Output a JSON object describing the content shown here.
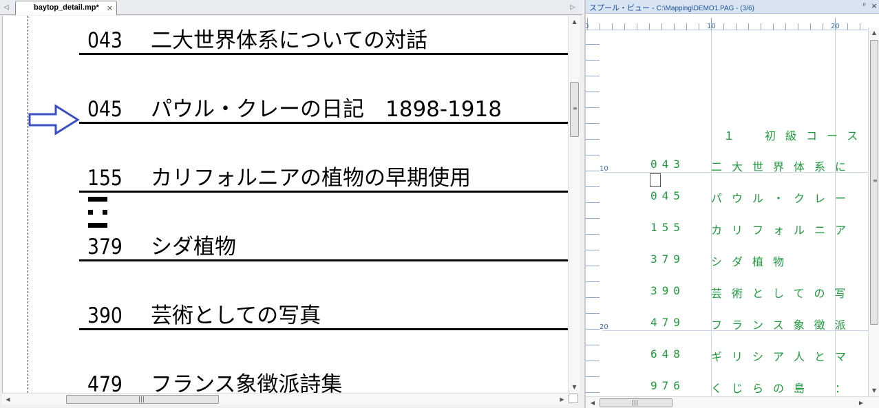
{
  "editor": {
    "tab": {
      "label": "baytop_detail.mp*",
      "close_glyph": "×"
    },
    "nav_left_glyph": "◁",
    "nav_right_glyph": "▷",
    "rows": [
      {
        "code": "043",
        "title": "二大世界体系についての対話"
      },
      {
        "code": "045",
        "title": "パウル・クレーの日記　1898-1918"
      },
      {
        "code": "155",
        "title": "カリフォルニアの植物の早期使用"
      },
      {
        "code": "379",
        "title": "シダ植物"
      },
      {
        "code": "390",
        "title": "芸術としての写真"
      },
      {
        "code": "479",
        "title": "フランス象徴派詩集"
      }
    ],
    "arrow_color": "#3a4fc4"
  },
  "spool": {
    "title": "スプール・ビュー - ",
    "path": "C:\\Mapping\\DEMO1.PAG - (3/6)",
    "pin_glyph": "ᵖ",
    "close_glyph": "×",
    "ruler_h_labels": [
      "0",
      "10",
      "20"
    ],
    "ruler_v_labels": [
      "10",
      "20"
    ],
    "heading": "１　初級コース",
    "rows": [
      {
        "code": "043",
        "text": "二大世界体系に"
      },
      {
        "code": "045",
        "text": "パウル・クレー"
      },
      {
        "code": "155",
        "text": "カリフォルニア"
      },
      {
        "code": "379",
        "text": "シダ植物"
      },
      {
        "code": "390",
        "text": "芸術としての写"
      },
      {
        "code": "479",
        "text": "フランス象徴派"
      },
      {
        "code": "648",
        "text": "ギリシア人とマ"
      },
      {
        "code": "976",
        "text": "くじらの島　："
      }
    ],
    "text_color": "#1e9a3c"
  }
}
